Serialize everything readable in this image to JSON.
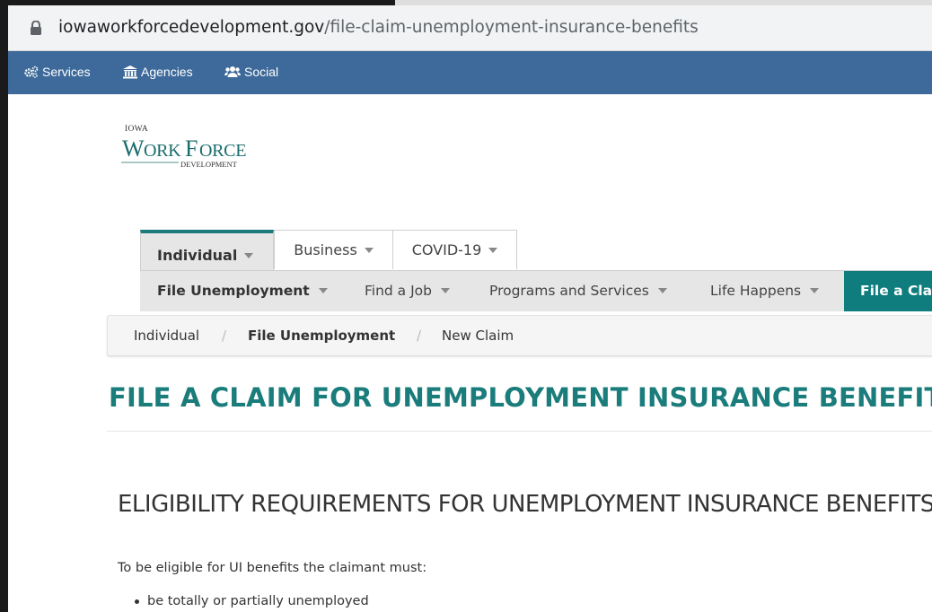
{
  "browser": {
    "url_host": "iowaworkforcedevelopment.gov",
    "url_path": "/file-claim-unemployment-insurance-benefits"
  },
  "utility_bar": {
    "items": [
      {
        "label": "Services",
        "icon": "gears-icon"
      },
      {
        "label": "Agencies",
        "icon": "institution-icon"
      },
      {
        "label": "Social",
        "icon": "users-icon"
      }
    ],
    "background": "#3d6a9a"
  },
  "logo": {
    "line1": "IOWA",
    "line2": "WORKFORCE",
    "line3": "DEVELOPMENT"
  },
  "audience_tabs": [
    {
      "label": "Individual",
      "active": true
    },
    {
      "label": "Business",
      "active": false
    },
    {
      "label": "COVID-19",
      "active": false
    }
  ],
  "sub_nav": {
    "items": [
      {
        "label": "File Unemployment",
        "bold": true
      },
      {
        "label": "Find a Job",
        "bold": false
      },
      {
        "label": "Programs and Services",
        "bold": false
      },
      {
        "label": "Life Happens",
        "bold": false
      }
    ],
    "cta_label": "File a Claim",
    "cta_color": "#0f7d7d"
  },
  "breadcrumb": {
    "items": [
      "Individual",
      "File Unemployment",
      "New Claim"
    ]
  },
  "page": {
    "title": "FILE A CLAIM FOR UNEMPLOYMENT INSURANCE BENEFITS",
    "title_color": "#1b7c7c",
    "section_heading": "ELIGIBILITY REQUIREMENTS FOR UNEMPLOYMENT INSURANCE BENEFITS",
    "intro": "To be eligible for UI benefits the claimant must:",
    "bullets": [
      "be totally or partially unemployed"
    ]
  }
}
